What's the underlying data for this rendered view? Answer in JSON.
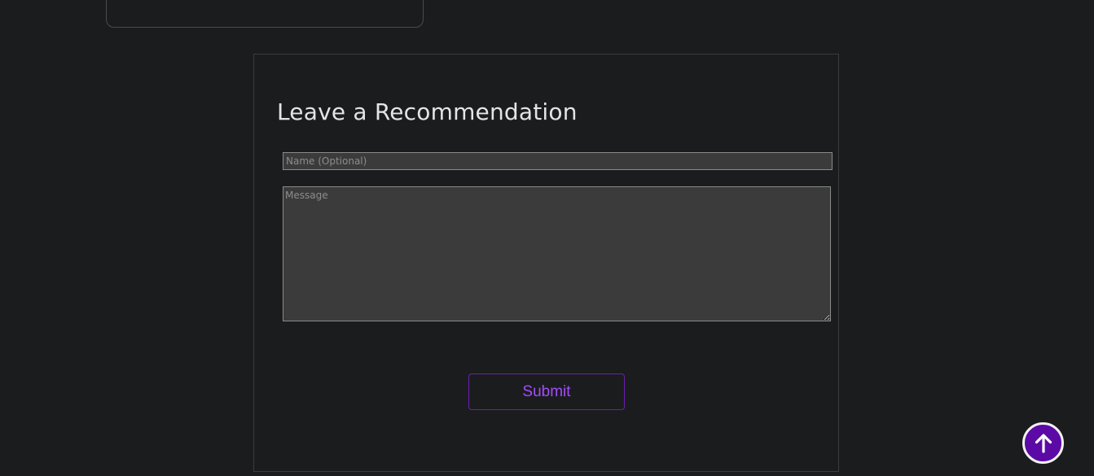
{
  "form": {
    "title": "Leave a Recommendation",
    "name_placeholder": "Name (Optional)",
    "message_placeholder": "Message",
    "submit_label": "Submit"
  },
  "scroll_top": {
    "icon": "arrow-up-icon"
  },
  "colors": {
    "background": "#1b1c1e",
    "accent": "#a24dfa",
    "accent_border": "#6a1fb0",
    "scroll_button_fill": "#5c0aa6"
  }
}
